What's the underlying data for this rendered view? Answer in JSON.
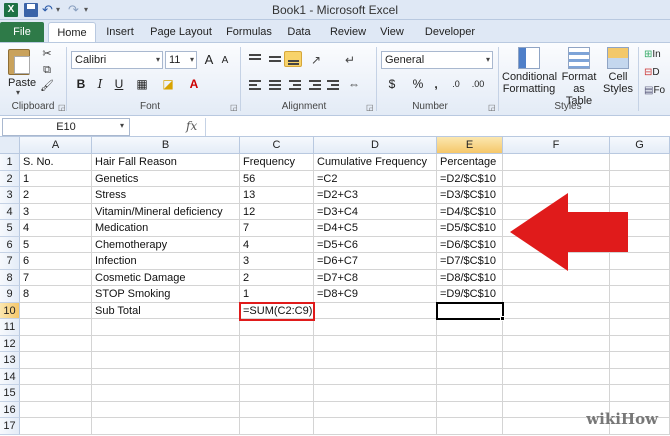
{
  "window": {
    "title": "Book1  -  Microsoft Excel"
  },
  "qat": {
    "logo": "X"
  },
  "tabs": [
    "File",
    "Home",
    "Insert",
    "Page Layout",
    "Formulas",
    "Data",
    "Review",
    "View",
    "Developer"
  ],
  "ribbon": {
    "clipboard": {
      "paste_label": "Paste",
      "group_label": "Clipboard"
    },
    "font": {
      "name": "Calibri",
      "size": "11",
      "bold": "B",
      "italic": "I",
      "underline": "U",
      "grow": "A",
      "shrink": "A",
      "group_label": "Font"
    },
    "alignment": {
      "group_label": "Alignment"
    },
    "number": {
      "format": "General",
      "currency": "$",
      "percent": "%",
      "comma": ",",
      "group_label": "Number"
    },
    "styles": {
      "conditional_line1": "Conditional",
      "conditional_line2": "Formatting",
      "format_table_line1": "Format",
      "format_table_line2": "as Table",
      "cell_styles_line1": "Cell",
      "cell_styles_line2": "Styles",
      "group_label": "Styles"
    },
    "cells": {
      "insert": "In",
      "delete": "D",
      "format": "Fo"
    }
  },
  "formula_bar": {
    "name_box": "E10",
    "fx": "fx",
    "value": ""
  },
  "sheet": {
    "columns": [
      "A",
      "B",
      "C",
      "D",
      "E",
      "F",
      "G"
    ],
    "rows": [
      "1",
      "2",
      "3",
      "4",
      "5",
      "6",
      "7",
      "8",
      "9",
      "10",
      "11",
      "12",
      "13",
      "14",
      "15",
      "16",
      "17"
    ],
    "data": [
      [
        "S. No.",
        "Hair Fall Reason",
        "Frequency",
        "Cumulative Frequency",
        "Percentage"
      ],
      [
        "1",
        "Genetics",
        "56",
        "=C2",
        "=D2/$C$10"
      ],
      [
        "2",
        "Stress",
        "13",
        "=D2+C3",
        "=D3/$C$10"
      ],
      [
        "3",
        "Vitamin/Mineral deficiency",
        "12",
        "=D3+C4",
        "=D4/$C$10"
      ],
      [
        "4",
        "Medication",
        "7",
        "=D4+C5",
        "=D5/$C$10"
      ],
      [
        "5",
        "Chemotherapy",
        "4",
        "=D5+C6",
        "=D6/$C$10"
      ],
      [
        "6",
        "Infection",
        "3",
        "=D6+C7",
        "=D7/$C$10"
      ],
      [
        "7",
        "Cosmetic Damage",
        "2",
        "=D7+C8",
        "=D8/$C$10"
      ],
      [
        "8",
        "STOP Smoking",
        "1",
        "=D8+C9",
        "=D9/$C$10"
      ],
      [
        "",
        "Sub Total",
        "=SUM(C2:C9)",
        "",
        ""
      ]
    ]
  },
  "colors": {
    "highlight_red": "#e01b1b",
    "excel_green": "#2e7a48"
  },
  "watermark": "wikiHow"
}
